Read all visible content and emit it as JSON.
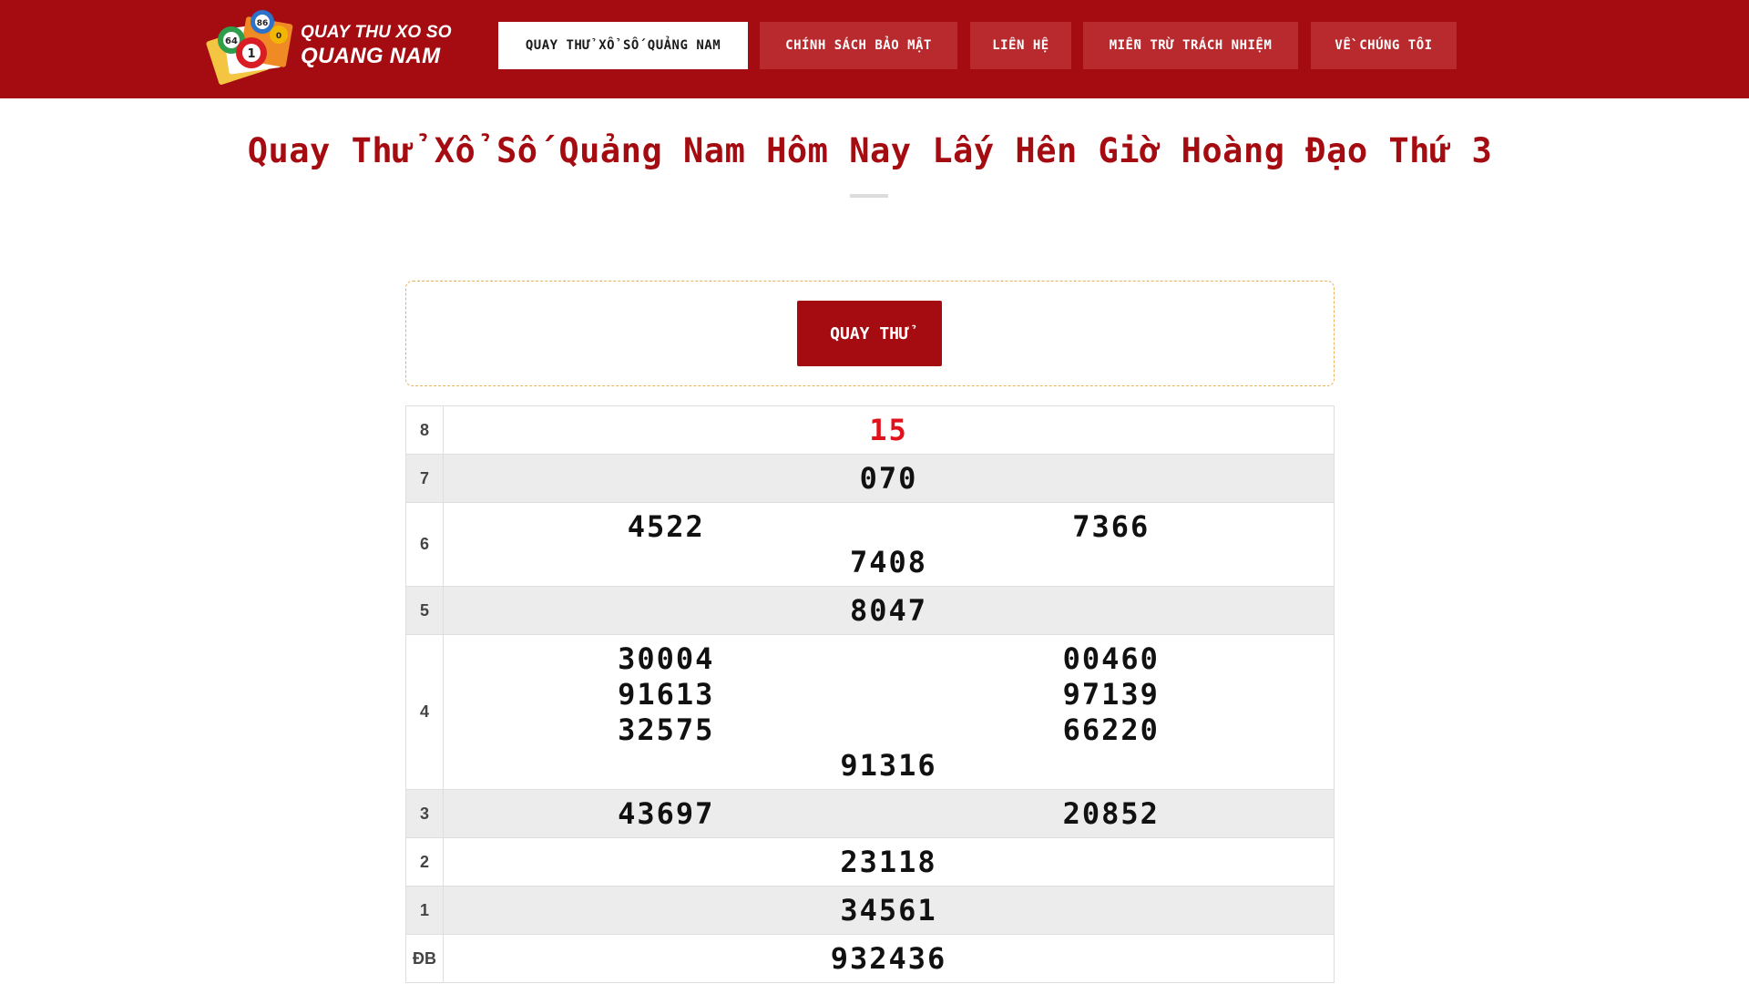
{
  "header": {
    "logo": {
      "line1": "QUAY THU XO SO",
      "line2": "QUANG NAM",
      "ball_labels": [
        "64",
        "86",
        "1",
        "0"
      ]
    },
    "nav": [
      {
        "label": "QUAY THỬ XỔ SỐ QUẢNG NAM",
        "active": true
      },
      {
        "label": "CHÍNH SÁCH BẢO MẬT",
        "active": false
      },
      {
        "label": "LIÊN HỆ",
        "active": false
      },
      {
        "label": "MIỄN TRỪ TRÁCH NHIỆM",
        "active": false
      },
      {
        "label": "VỀ CHÚNG TÔI",
        "active": false
      }
    ]
  },
  "page_title": "Quay Thử Xổ Số Quảng Nam Hôm Nay Lấy Hên Giờ Hoàng Đạo Thứ 3",
  "spin_button": "QUAY THỬ",
  "results": {
    "rows": [
      {
        "prize": "8",
        "numbers": [
          "15"
        ]
      },
      {
        "prize": "7",
        "numbers": [
          "070"
        ]
      },
      {
        "prize": "6",
        "numbers": [
          "4522",
          "7366",
          "7408"
        ]
      },
      {
        "prize": "5",
        "numbers": [
          "8047"
        ]
      },
      {
        "prize": "4",
        "numbers": [
          "30004",
          "00460",
          "91613",
          "97139",
          "32575",
          "66220",
          "91316"
        ]
      },
      {
        "prize": "3",
        "numbers": [
          "43697",
          "20852"
        ]
      },
      {
        "prize": "2",
        "numbers": [
          "23118"
        ]
      },
      {
        "prize": "1",
        "numbers": [
          "34561"
        ]
      },
      {
        "prize": "ĐB",
        "numbers": [
          "932436"
        ]
      }
    ]
  },
  "colors": {
    "brand_red": "#a50c11",
    "highlight_red": "#e0121c",
    "spin_border": "#e7b25a"
  }
}
